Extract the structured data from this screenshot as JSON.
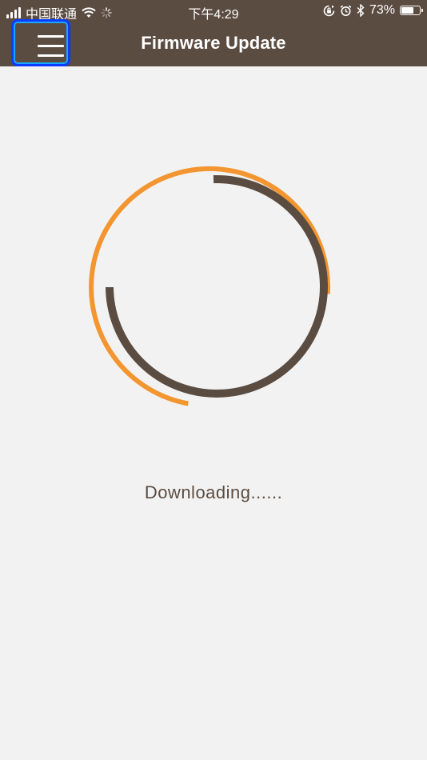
{
  "status_bar": {
    "carrier": "中国联通",
    "time": "下午4:29",
    "battery_percent": "73%",
    "battery_level": 0.73
  },
  "header": {
    "title": "Firmware Update",
    "menu_icon": "hamburger-menu-icon"
  },
  "main": {
    "status_text": "Downloading......"
  },
  "colors": {
    "header_bg": "#5b4c41",
    "accent_orange": "#f39530",
    "ring_brown": "#5b4c41",
    "page_bg": "#f2f2f2",
    "focus_outline": "#0a3cff"
  }
}
